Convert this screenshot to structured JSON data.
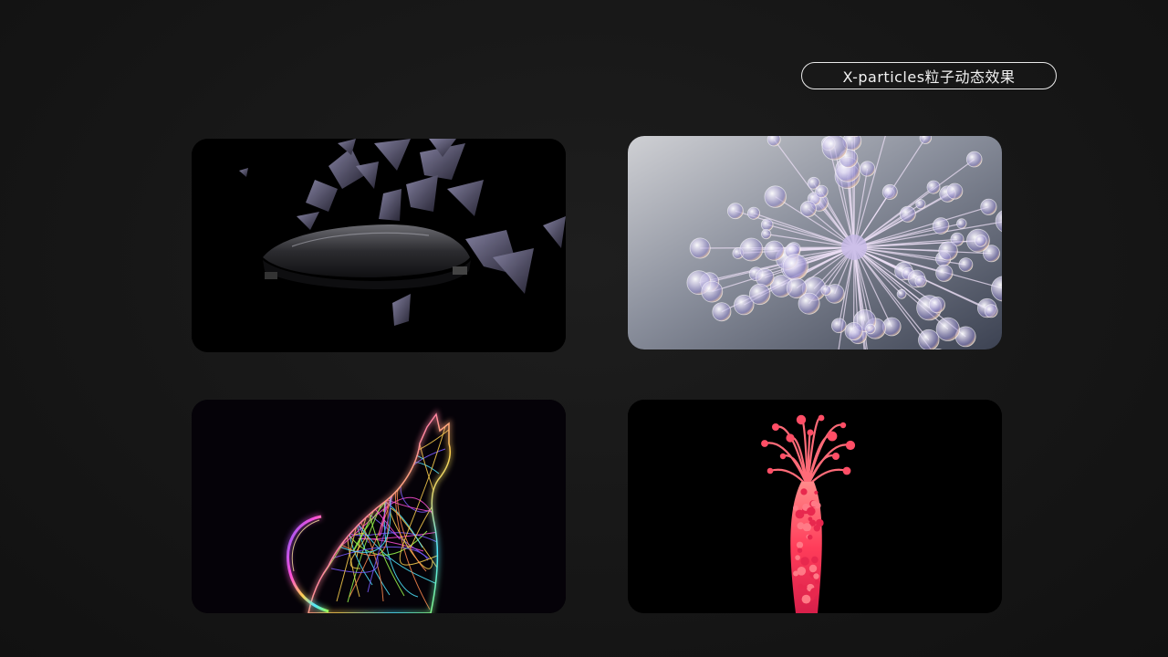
{
  "header": {
    "title": "X-particles粒子动态效果"
  },
  "gallery": [
    {
      "id": "card-1",
      "subject": "shattered-device-render-icon"
    },
    {
      "id": "card-2",
      "subject": "bubble-dandelion-render-icon"
    },
    {
      "id": "card-3",
      "subject": "neon-cat-render-icon"
    },
    {
      "id": "card-4",
      "subject": "coral-flower-render-icon"
    }
  ],
  "colors": {
    "background": "#161616",
    "pill_border": "#e9e9e9",
    "pill_text": "#f2f2f2",
    "neon_green": "#2bff6a",
    "neon_blue": "#2a7bff",
    "coral": "#ff5a6e"
  }
}
